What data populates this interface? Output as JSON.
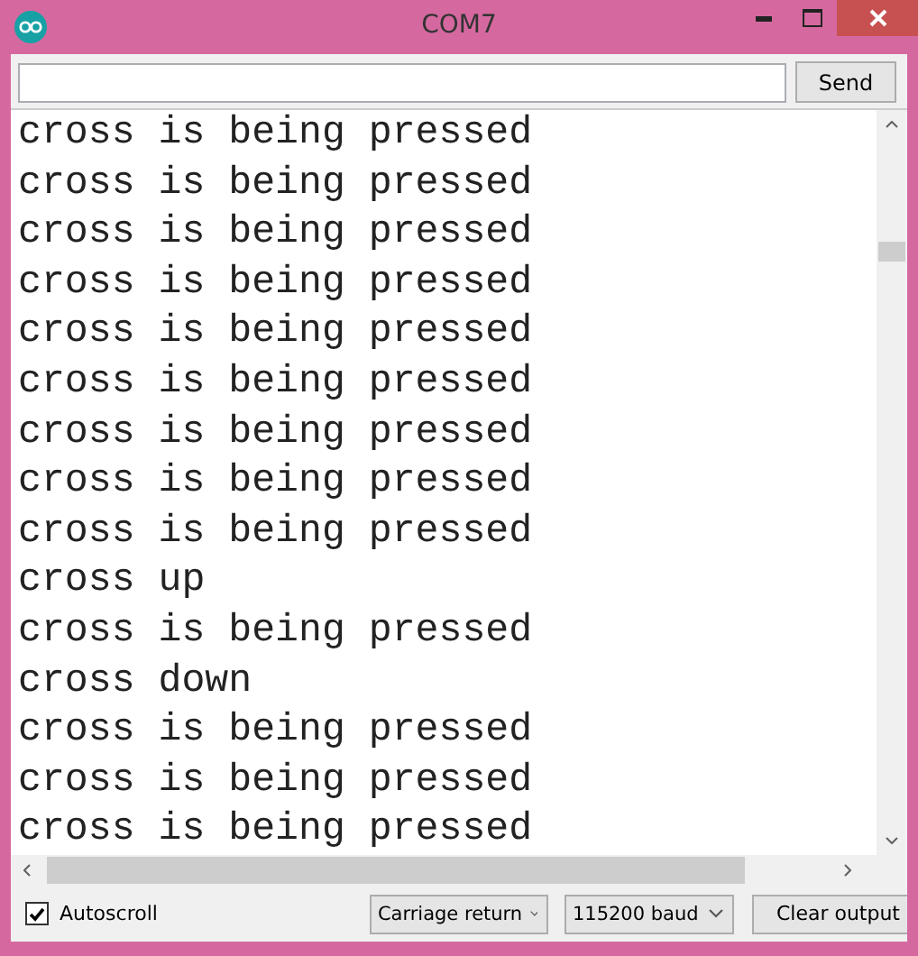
{
  "window": {
    "title": "COM7"
  },
  "input": {
    "button": "Send"
  },
  "output": {
    "lines": [
      "cross is being pressed",
      "cross is being pressed",
      "cross is being pressed",
      "cross is being pressed",
      "cross is being pressed",
      "cross is being pressed",
      "cross is being pressed",
      "cross is being pressed",
      "cross is being pressed",
      "cross up",
      "cross is being pressed",
      "cross down",
      "cross is being pressed",
      "cross is being pressed",
      "cross is being pressed"
    ]
  },
  "footer": {
    "autoscroll": {
      "label": "Autoscroll",
      "checked": true
    },
    "line_ending": "Carriage return",
    "baud": "115200 baud",
    "clear": "Clear output"
  }
}
